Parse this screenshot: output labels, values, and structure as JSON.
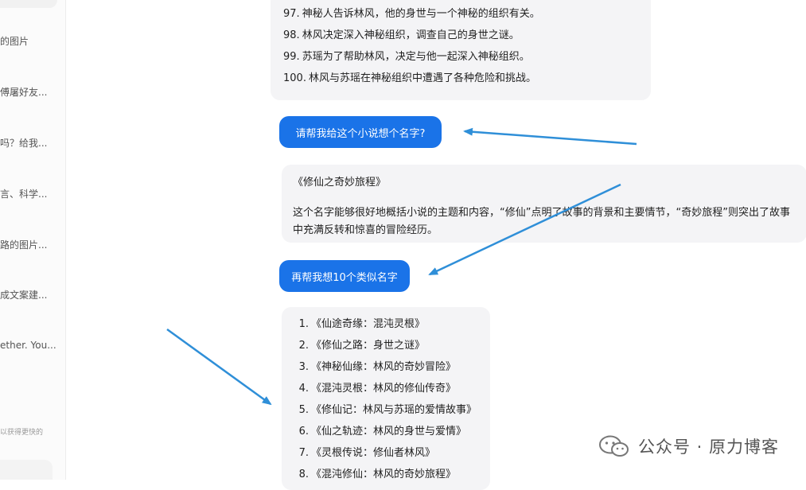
{
  "sidebar": {
    "items": [
      {
        "label": "的图片"
      },
      {
        "label": "傅屠好友..."
      },
      {
        "label": "吗？给我..."
      },
      {
        "label": "言、科学..."
      },
      {
        "label": "路的图片..."
      },
      {
        "label": "成文案建..."
      },
      {
        "label": "ether. You..."
      }
    ],
    "footer_note": "以获得更快的"
  },
  "chat": {
    "card1_items": [
      {
        "num": "97.",
        "text": "神秘人告诉林风，他的身世与一个神秘的组织有关。"
      },
      {
        "num": "98.",
        "text": "林风决定深入神秘组织，调查自己的身世之谜。"
      },
      {
        "num": "99.",
        "text": "苏瑶为了帮助林风，决定与他一起深入神秘组织。"
      },
      {
        "num": "100.",
        "text": "林风与苏瑶在神秘组织中遭遇了各种危险和挑战。"
      }
    ],
    "user_msg_1": "请帮我给这个小说想个名字?",
    "reply_title": "《修仙之奇妙旅程》",
    "reply_desc": "这个名字能够很好地概括小说的主题和内容，“修仙”点明了故事的背景和主要情节，“奇妙旅程”则突出了故事中充满反转和惊喜的冒险经历。",
    "user_msg_2": "再帮我想10个类似名字",
    "names": [
      {
        "num": "1.",
        "text": "《仙途奇缘：混沌灵根》"
      },
      {
        "num": "2.",
        "text": "《修仙之路：身世之谜》"
      },
      {
        "num": "3.",
        "text": "《神秘仙缘：林风的奇妙冒险》"
      },
      {
        "num": "4.",
        "text": "《混沌灵根：林风的修仙传奇》"
      },
      {
        "num": "5.",
        "text": "《修仙记：林风与苏瑶的爱情故事》"
      },
      {
        "num": "6.",
        "text": "《仙之轨迹：林风的身世与爱情》"
      },
      {
        "num": "7.",
        "text": "《灵根传说：修仙者林风》"
      },
      {
        "num": "8.",
        "text": "《混沌修仙：林风的奇妙旅程》"
      }
    ]
  },
  "watermark": {
    "text": "公众号 · 原力博客",
    "icon": "wechat-icon"
  },
  "colors": {
    "user_bubble": "#1a73e8",
    "ai_card": "#f4f4f6",
    "arrow": "#2f8fd8"
  }
}
